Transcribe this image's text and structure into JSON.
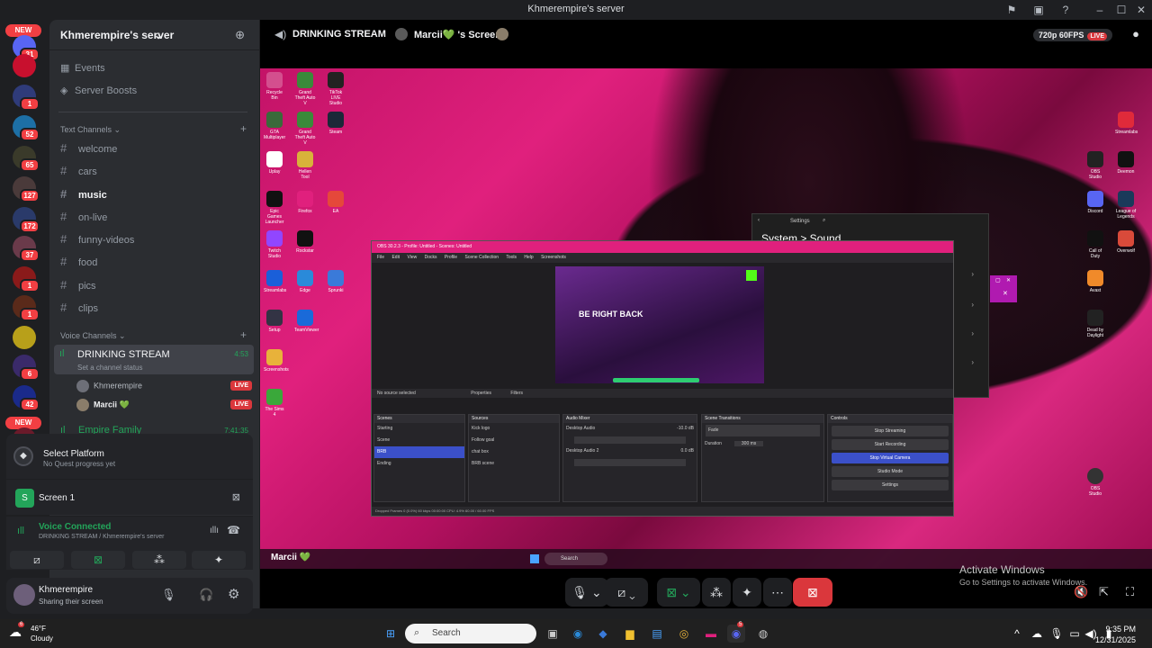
{
  "window": {
    "title": "Khmerempire's server"
  },
  "server_rail": {
    "new_label_top": "NEW",
    "new_label_bottom": "NEW",
    "badges": [
      "31",
      "1",
      "52",
      "65",
      "127",
      "172",
      "37",
      "1",
      "1",
      "6",
      "42",
      "11"
    ]
  },
  "server": {
    "name": "Khmerempire's server",
    "nav": [
      {
        "label": "Events",
        "icon": "calendar-icon"
      },
      {
        "label": "Server Boosts",
        "icon": "boost-icon"
      }
    ],
    "text_category": "Text Channels",
    "text_channels": [
      "welcome",
      "cars",
      "music",
      "on-live",
      "funny-videos",
      "food",
      "pics",
      "clips"
    ],
    "active_channel": "music",
    "voice_category": "Voice Channels",
    "voice_room": {
      "name": "DRINKING STREAM",
      "time": "4:53",
      "status_placeholder": "Set a channel status",
      "users": [
        {
          "name": "Khmerempire",
          "badge": "LIVE"
        },
        {
          "name": "Marcii 💚",
          "badge": "LIVE"
        }
      ]
    },
    "second_voice_room": {
      "name": "Empire Family",
      "time": "7:41:35"
    }
  },
  "quest": {
    "title": "Select Platform",
    "subtitle": "No Quest progress yet"
  },
  "screen_share": {
    "label": "Screen 1"
  },
  "voice_status": {
    "title": "Voice Connected",
    "subtitle": "DRINKING STREAM / Khmerempire's server"
  },
  "user": {
    "name": "Khmerempire",
    "status": "Sharing their screen"
  },
  "stage": {
    "channel": "DRINKING STREAM",
    "screen_owner": "Marcii💚 's Screen",
    "quality": "720p 60FPS",
    "live": "LIVE",
    "viewer_name": "Marcii 💚"
  },
  "obs": {
    "title": "OBS 30.2.3 - Profile: Untitled - Scenes: Untitled",
    "menu": [
      "File",
      "Edit",
      "View",
      "Docks",
      "Profile",
      "Scene Collection",
      "Tools",
      "Help",
      "Screenshots"
    ],
    "no_source": "No source selected",
    "properties": "Properties",
    "filters": "Filters",
    "preview_text": "BE RIGHT BACK",
    "scenes_header": "Scenes",
    "scenes": [
      "Starting",
      "Scene",
      "BRB",
      "Ending"
    ],
    "selected_scene": "BRB",
    "sources_header": "Sources",
    "sources": [
      "Kick logo",
      "Follow goal",
      "chat box",
      "BRB scene"
    ],
    "mixer_header": "Audio Mixer",
    "mixer_tracks": [
      {
        "name": "Desktop Audio",
        "db": "-10.0 dB"
      },
      {
        "name": "Desktop Audio 2",
        "db": "0.0 dB"
      }
    ],
    "transitions_header": "Scene Transitions",
    "transition": "Fade",
    "duration_label": "Duration",
    "duration": "300 ms",
    "controls_header": "Controls",
    "controls": [
      "Stop Streaming",
      "Start Recording",
      "Stop Virtual Camera",
      "Studio Mode",
      "Settings"
    ],
    "status": "Dropped Frames 0 (0.0%)   60 kbps   00:00:00   CPU: 4.9%   60.00 / 60.00 FPS"
  },
  "settings_window": {
    "title": "Settings",
    "breadcrumb": "System  >  Sound"
  },
  "desktop_icons_left": [
    "Recycle Bin",
    "Grand Theft Auto V",
    "TikTok LIVE Studio",
    "GTA Multiplayer",
    "Grand Theft Auto V",
    "Steam",
    "Uplay",
    "Hellen Tool",
    "Epic Games Launcher",
    "Firefox",
    "EA",
    "Twitch Studio",
    "Rockstar",
    "Streamlabs",
    "Edge",
    "Sprunki",
    "Setup",
    "TeamViewer",
    "Screenshots",
    "The Sims 4"
  ],
  "desktop_icons_right": [
    "Streamlabs",
    "OBS Studio",
    "Deemon",
    "Discord",
    "League of Legends",
    "Call of Duty",
    "Overwolf",
    "Avast",
    "Dead by Daylight",
    "OBS Studio"
  ],
  "activate": {
    "title": "Activate Windows",
    "subtitle": "Go to Settings to activate Windows."
  },
  "taskbar": {
    "weather_temp": "46°F",
    "weather_desc": "Cloudy",
    "weather_badge": "6",
    "search_placeholder": "Search",
    "time": "9:35 PM",
    "date": "12/31/2025",
    "discord_badge": "5"
  },
  "colors": {
    "accent_red": "#da373c",
    "voice_green": "#23a55a",
    "obs_pink": "#e0207d",
    "obs_blue": "#3b50c9"
  }
}
